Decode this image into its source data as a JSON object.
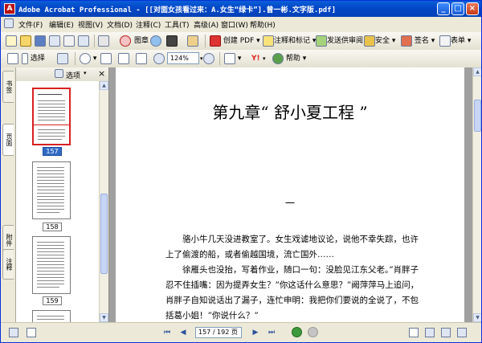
{
  "window": {
    "title": "Adobe Acrobat Professional - [[对面女孩看过来：A.女生“绿卡”].曾一彬.文字版.pdf]",
    "minimize_glyph": "_",
    "maximize_glyph": "□",
    "close_glyph": "×"
  },
  "menu": [
    "文件(F)",
    "编辑(E)",
    "视图(V)",
    "文档(D)",
    "注释(C)",
    "工具(T)",
    "高级(A)",
    "窗口(W)",
    "帮助(H)"
  ],
  "toolbar1": {
    "create_pdf": "创建 PDF",
    "comment_markup": "注释和标记",
    "send_review": "发送供审阅",
    "secure": "安全",
    "sign": "签名",
    "forms": "表单"
  },
  "toolbar2": {
    "select": "选择",
    "zoom": "124%",
    "help": "帮助"
  },
  "nav_tabs": [
    "书签",
    "页面",
    "附件",
    "注释"
  ],
  "panel": {
    "options_label": "选项",
    "close_glyph": "×",
    "thumbnails": [
      {
        "label": "157",
        "selected": true
      },
      {
        "label": "158",
        "selected": false
      },
      {
        "label": "159",
        "selected": false
      }
    ]
  },
  "document": {
    "chapter_title": "第九章“ 舒小夏工程 ”",
    "section_mark": "一",
    "para1": "骆小牛几天没进教室了。女生戏谑地议论，说他不幸失踪，也许上了偷渡的船，或者偷越国境，流亡国外……",
    "para2": "徐雁头也没抬，写着作业，随口一句：没脸见江东父老。”肖胖子忍不住插嘴：因为提弄女生？”你这话什么意思？”阙萍萍马上追问，肖胖子自知说话出了漏子，连忙申明：我把你们要说的全说了，不包括葛小姐！”你说什么？”"
  },
  "status": {
    "page_display": "157 / 192 页",
    "first_glyph": "⏮",
    "prev_glyph": "◀",
    "next_glyph": "▶",
    "last_glyph": "⏭"
  },
  "colors": {
    "titlebar": "#0347c7",
    "selected_page": "#316ac5",
    "selected_thumb_border": "#d82020"
  }
}
